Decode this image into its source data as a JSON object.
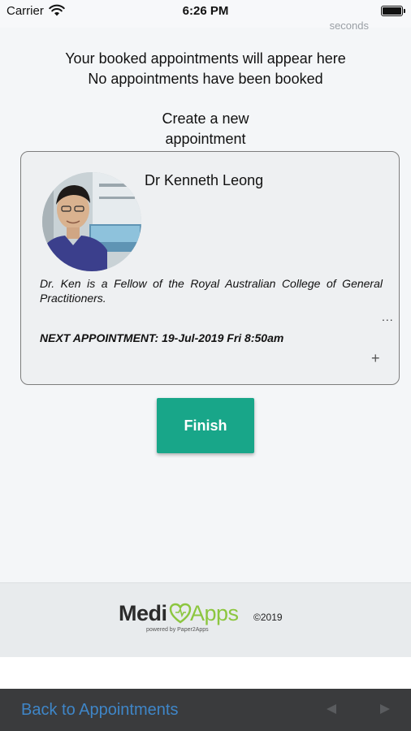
{
  "status_bar": {
    "carrier": "Carrier",
    "time": "6:26 PM"
  },
  "header": {
    "cut_off_text": "seconds"
  },
  "messages": {
    "line1": "Your booked appointments will appear here",
    "line2": "No appointments have been booked"
  },
  "create": {
    "line1": "Create a new",
    "line2": "appointment"
  },
  "doctor_card": {
    "name": "Dr Kenneth Leong",
    "bio": "Dr. Ken is a Fellow of the Royal Australian College of General Practitioners.",
    "more": "...",
    "next_appointment": "NEXT APPOINTMENT: 19-Jul-2019 Fri 8:50am",
    "add": "+"
  },
  "finish_button": {
    "label": "Finish"
  },
  "footer": {
    "logo_medi": "Medi",
    "logo_apps": "Apps",
    "logo_tagline": "powered by Paper2Apps",
    "copyright": "©2019"
  },
  "toolbar": {
    "back_label": "Back to Appointments"
  },
  "icons": {
    "wifi": "wifi-icon",
    "battery": "battery-icon",
    "more": "more-icon",
    "plus": "plus-icon",
    "nav_back": "nav-back-icon",
    "nav_forward": "nav-forward-icon"
  },
  "colors": {
    "accent": "#18a689",
    "link": "#3f86c8",
    "logo_green": "#8cc63f",
    "toolbar_bg": "#3a3b3d"
  }
}
